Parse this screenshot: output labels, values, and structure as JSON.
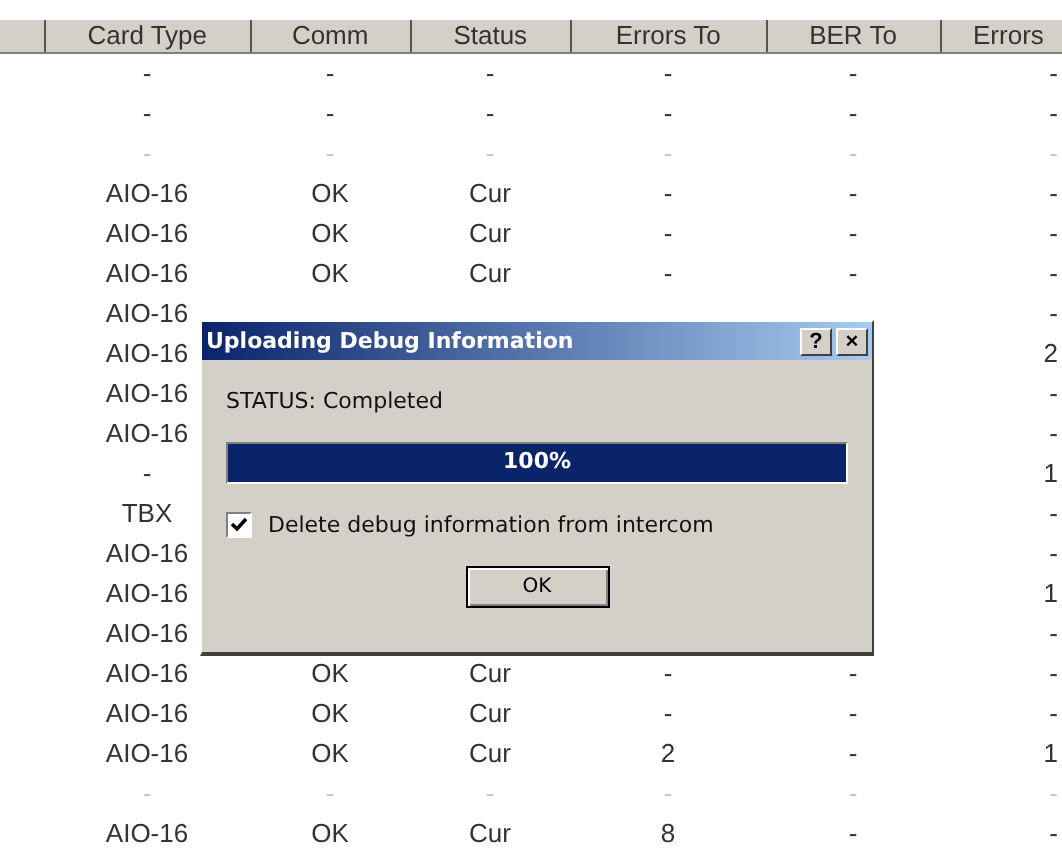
{
  "table": {
    "columns": [
      "Card Type",
      "Comm",
      "Status",
      "Errors To",
      "BER To",
      "Errors"
    ],
    "rows": [
      {
        "dim": false,
        "cells": [
          "-",
          "-",
          "-",
          "-",
          "-",
          "-"
        ]
      },
      {
        "dim": false,
        "cells": [
          "-",
          "-",
          "-",
          "-",
          "-",
          "-"
        ]
      },
      {
        "dim": true,
        "cells": [
          "-",
          "-",
          "-",
          "-",
          "-",
          "-"
        ]
      },
      {
        "dim": false,
        "cells": [
          "AIO-16",
          "OK",
          "Cur",
          "-",
          "-",
          "-"
        ]
      },
      {
        "dim": false,
        "cells": [
          "AIO-16",
          "OK",
          "Cur",
          "-",
          "-",
          "-"
        ]
      },
      {
        "dim": false,
        "cells": [
          "AIO-16",
          "OK",
          "Cur",
          "-",
          "-",
          "-"
        ]
      },
      {
        "dim": false,
        "cells": [
          "AIO-16",
          null,
          null,
          null,
          null,
          "-"
        ]
      },
      {
        "dim": false,
        "cells": [
          "AIO-16",
          null,
          null,
          null,
          null,
          "2"
        ]
      },
      {
        "dim": false,
        "cells": [
          "AIO-16",
          null,
          null,
          null,
          null,
          "-"
        ]
      },
      {
        "dim": false,
        "cells": [
          "AIO-16",
          null,
          null,
          null,
          null,
          "-"
        ]
      },
      {
        "dim": false,
        "cells": [
          "-",
          null,
          null,
          null,
          null,
          "1"
        ]
      },
      {
        "dim": false,
        "cells": [
          "TBX",
          null,
          null,
          null,
          null,
          "-"
        ]
      },
      {
        "dim": false,
        "cells": [
          "AIO-16",
          null,
          null,
          null,
          null,
          "-"
        ]
      },
      {
        "dim": false,
        "cells": [
          "AIO-16",
          null,
          null,
          null,
          null,
          "1"
        ]
      },
      {
        "dim": false,
        "cells": [
          "AIO-16",
          null,
          null,
          null,
          null,
          "-"
        ]
      },
      {
        "dim": false,
        "cells": [
          "AIO-16",
          "OK",
          "Cur",
          "-",
          "-",
          "-"
        ]
      },
      {
        "dim": false,
        "cells": [
          "AIO-16",
          "OK",
          "Cur",
          "-",
          "-",
          "-"
        ]
      },
      {
        "dim": false,
        "cells": [
          "AIO-16",
          "OK",
          "Cur",
          "2",
          "-",
          "1"
        ]
      },
      {
        "dim": true,
        "cells": [
          "-",
          "-",
          "-",
          "-",
          "-",
          "-"
        ]
      },
      {
        "dim": false,
        "cells": [
          "AIO-16",
          "OK",
          "Cur",
          "8",
          "-",
          "-"
        ]
      }
    ]
  },
  "dialog": {
    "title": "Uploading Debug Information",
    "help": "?",
    "close": "×",
    "status": "STATUS: Completed",
    "progress": {
      "level": 1,
      "label": "100%"
    },
    "checkbox": {
      "label": "Delete debug information from intercom",
      "checked": true
    },
    "buttons": [
      "OK"
    ]
  }
}
